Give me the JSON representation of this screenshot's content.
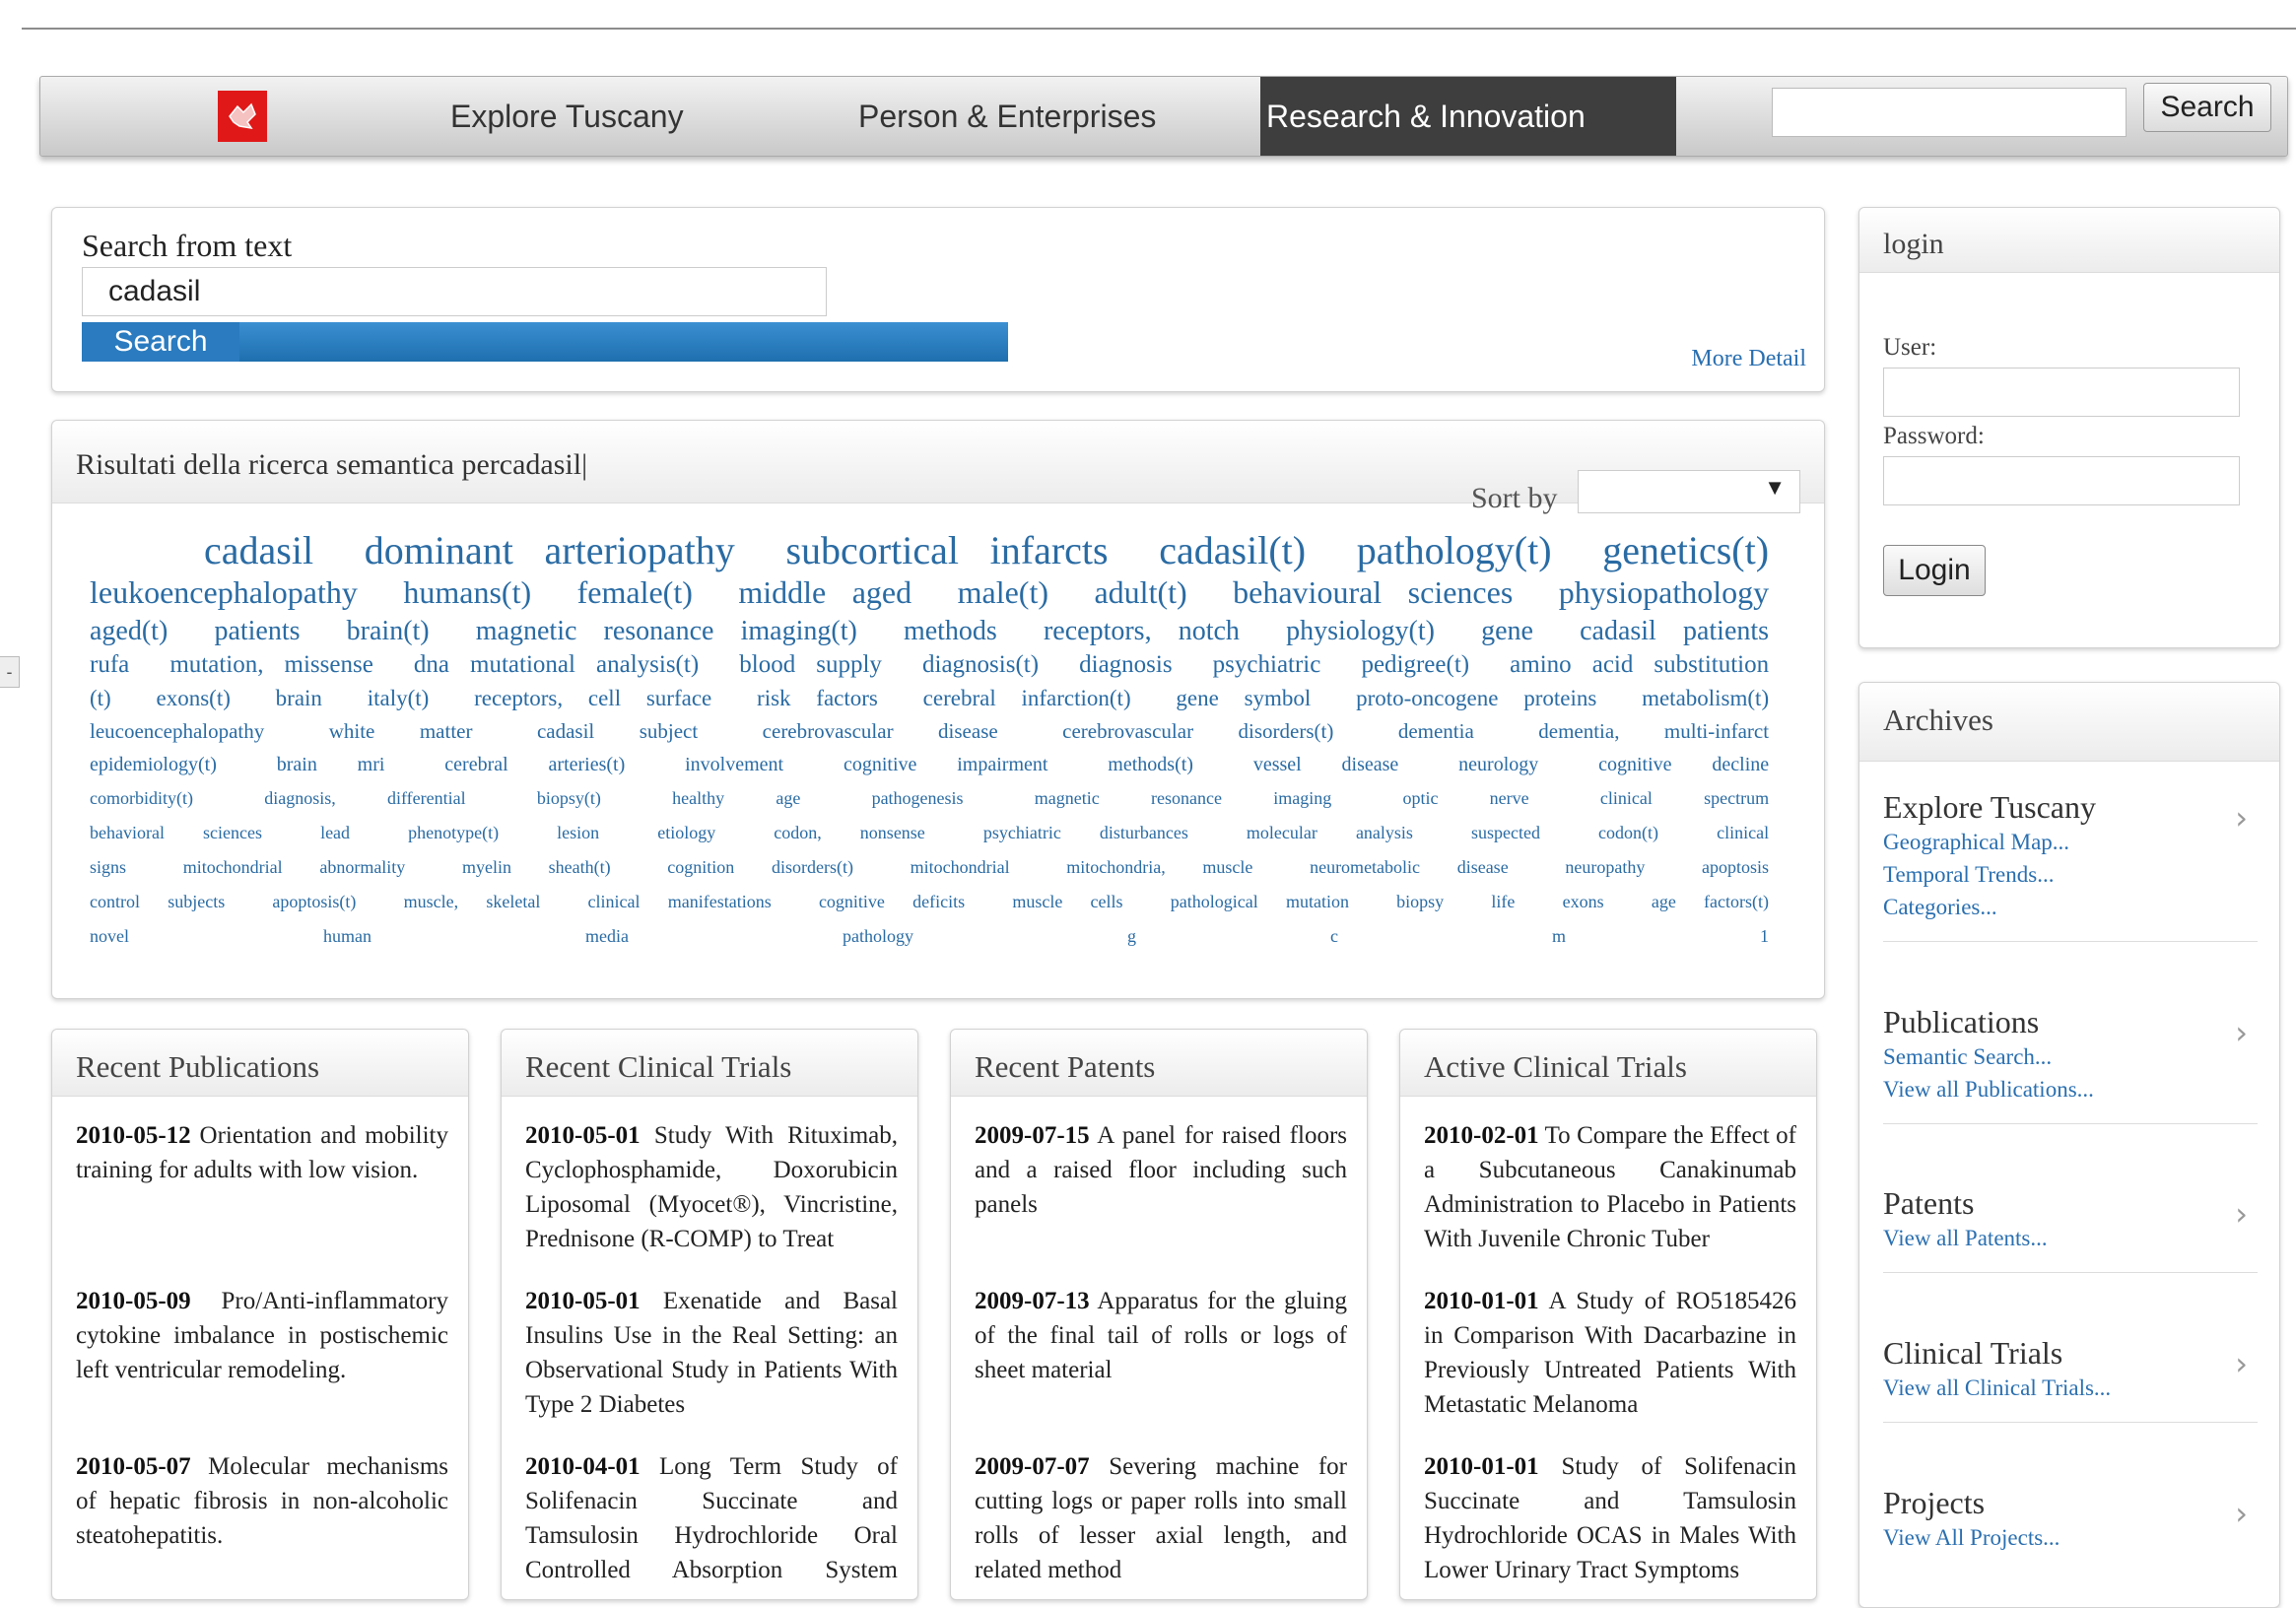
{
  "nav": {
    "items": [
      "Explore Tuscany",
      "Person & Enterprises",
      "Research & Innovation"
    ],
    "search_button": "Search"
  },
  "search": {
    "label": "Search from text",
    "value": "cadasil",
    "button": "Search",
    "more_detail": "More Detail"
  },
  "results": {
    "title": "Risultati della ricerca semantica percadasil|",
    "sort_by": "Sort by",
    "tag_lines": [
      [
        "cadasil",
        "dominant arteriopathy",
        "subcortical infarcts",
        "cadasil(t)",
        "pathology(t)",
        "genetics(t)"
      ],
      [
        "leukoencephalopathy",
        "humans(t)",
        "female(t)",
        "middle aged",
        "male(t)",
        "adult(t)",
        "behavioural sciences",
        "physiopathology"
      ],
      [
        "aged(t)",
        "patients",
        "brain(t)",
        "magnetic resonance imaging(t)",
        "methods",
        "receptors, notch",
        "physiology(t)",
        "gene",
        "cadasil patients"
      ],
      [
        "rufa",
        "mutation, missense",
        "dna mutational analysis(t)",
        "blood supply",
        "diagnosis(t)",
        "diagnosis",
        "psychiatric",
        "pedigree(t)",
        "amino acid substitution"
      ],
      [
        "(t)",
        "exons(t)",
        "brain",
        "italy(t)",
        "receptors, cell surface",
        "risk factors",
        "cerebral infarction(t)",
        "gene symbol",
        "proto-oncogene proteins",
        "metabolism(t)"
      ],
      [
        "leucoencephalopathy",
        "white matter",
        "cadasil subject",
        "cerebrovascular disease",
        "cerebrovascular disorders(t)",
        "dementia",
        "dementia, multi-infarct"
      ],
      [
        "epidemiology(t)",
        "brain mri",
        "cerebral arteries(t)",
        "involvement",
        "cognitive impairment",
        "methods(t)",
        "vessel disease",
        "neurology",
        "cognitive decline"
      ],
      [
        "comorbidity(t)",
        "diagnosis, differential",
        "biopsy(t)",
        "healthy age",
        "pathogenesis",
        "magnetic resonance imaging",
        "optic nerve",
        "clinical spectrum"
      ],
      [
        "behavioral sciences",
        "lead",
        "phenotype(t)",
        "lesion",
        "etiology",
        "codon, nonsense",
        "psychiatric disturbances",
        "molecular analysis",
        "suspected",
        "codon(t)",
        "clinical"
      ],
      [
        "signs",
        "mitochondrial abnormality",
        "myelin sheath(t)",
        "cognition disorders(t)",
        "mitochondrial",
        "mitochondria, muscle",
        "neurometabolic disease",
        "neuropathy",
        "apoptosis"
      ],
      [
        "control subjects",
        "apoptosis(t)",
        "muscle, skeletal",
        "clinical manifestations",
        "cognitive deficits",
        "muscle cells",
        "pathological mutation",
        "biopsy",
        "life",
        "exons",
        "age factors(t)"
      ],
      [
        "novel human",
        "media",
        "pathology",
        "g c",
        "m 1"
      ]
    ]
  },
  "cards": [
    {
      "title": "Recent Publications",
      "entries": [
        {
          "date": "2010-05-12",
          "text": "Orientation and mobility training for adults with low vision."
        },
        {
          "date": "2010-05-09",
          "text": "Pro/Anti-inflammatory cytokine imbalance in postischemic left ventricular remodeling."
        },
        {
          "date": "2010-05-07",
          "text": "Molecular mechanisms of hepatic fibrosis in non-alcoholic steatohepatitis."
        }
      ]
    },
    {
      "title": "Recent Clinical Trials",
      "entries": [
        {
          "date": "2010-05-01",
          "text": "Study With Rituximab, Cyclophosphamide, Doxorubicin Liposomal (Myocet®), Vincristine, Prednisone (R-COMP) to Treat"
        },
        {
          "date": "2010-05-01",
          "text": "Exenatide and Basal Insulins Use in the Real Setting: an Observational Study in Patients With Type 2 Diabetes"
        },
        {
          "date": "2010-04-01",
          "text": "Long Term Study of Solifenacin Succinate and Tamsulosin Hydrochloride Oral Controlled Absorption System (OCAS) in Males With Lower"
        }
      ]
    },
    {
      "title": "Recent Patents",
      "entries": [
        {
          "date": "2009-07-15",
          "text": "A panel for raised floors and a raised floor including such panels"
        },
        {
          "date": "2009-07-13",
          "text": "Apparatus for the gluing of the final tail of rolls or logs of sheet material"
        },
        {
          "date": "2009-07-07",
          "text": "Severing machine for cutting logs or paper rolls into small rolls of lesser axial length, and related method"
        }
      ]
    },
    {
      "title": "Active Clinical Trials",
      "entries": [
        {
          "date": "2010-02-01",
          "text": "To Compare the Effect of a Subcutaneous Canakinumab Administration to Placebo in Patients With Juvenile Chronic Tuber"
        },
        {
          "date": "2010-01-01",
          "text": "A Study of RO5185426 in Comparison With Dacarbazine in Previously Untreated Patients With Metastatic Melanoma"
        },
        {
          "date": "2010-01-01",
          "text": "Study of Solifenacin Succinate and Tamsulosin Hydrochloride OCAS in Males With Lower Urinary Tract Symptoms"
        }
      ]
    }
  ],
  "login": {
    "title": "login",
    "user_label": "User:",
    "password_label": "Password:",
    "button": "Login"
  },
  "archives": {
    "title": "Archives",
    "sections": [
      {
        "title": "Explore Tuscany",
        "links": [
          "Geographical Map...",
          "Temporal Trends...",
          "Categories..."
        ]
      },
      {
        "title": "Publications",
        "links": [
          "Semantic Search...",
          "View all Publications..."
        ]
      },
      {
        "title": "Patents",
        "links": [
          "View all Patents..."
        ]
      },
      {
        "title": "Clinical Trials",
        "links": [
          "View all Clinical Trials..."
        ]
      },
      {
        "title": "Projects",
        "links": [
          "View All Projects..."
        ]
      }
    ]
  },
  "icons": {
    "logo": "tuscany-region-logo-icon",
    "chevron": "chevron-right-icon",
    "dropdown": "caret-down-icon"
  },
  "colors": {
    "accent_blue": "#2a7bbf",
    "link_blue": "#2a6fb0",
    "logo_red": "#e01818",
    "active_nav": "#3e3e3e"
  }
}
